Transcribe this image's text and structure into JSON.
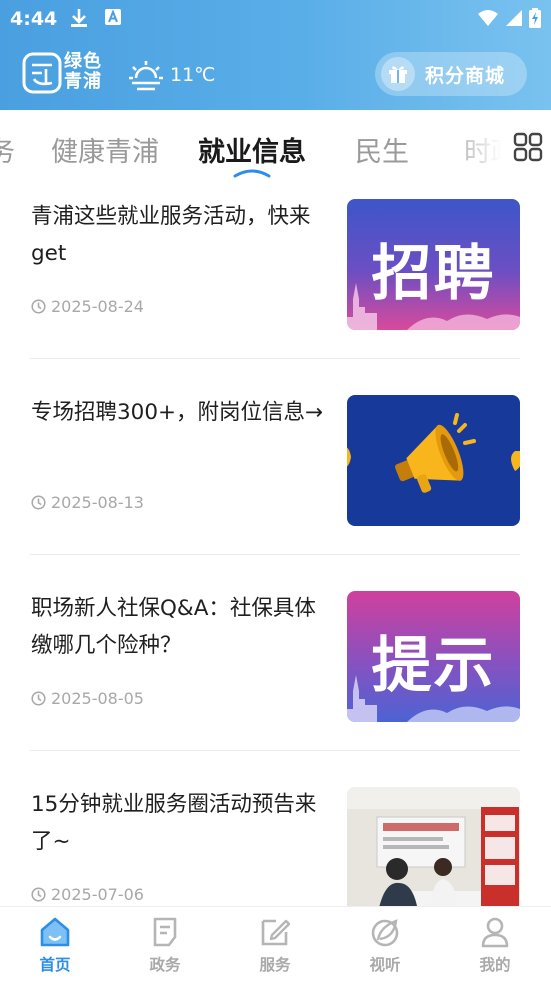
{
  "status_bar": {
    "time": "4:44"
  },
  "header": {
    "logo_line1": "绿色",
    "logo_line2": "青浦",
    "temperature": "11℃",
    "mall_label": "积分商城"
  },
  "tabs": [
    {
      "label": "务"
    },
    {
      "label": "健康青浦"
    },
    {
      "label": "就业信息",
      "active": true
    },
    {
      "label": "民生"
    },
    {
      "label": "时政"
    }
  ],
  "articles": [
    {
      "title": "青浦这些就业服务活动，快来get",
      "date": "2025-08-24",
      "thumb_text": "招聘",
      "thumb_kind": "banner"
    },
    {
      "title": "专场招聘300+，附岗位信息→",
      "date": "2025-08-13",
      "thumb_kind": "megaphone"
    },
    {
      "title": "职场新人社保Q&A：社保具体缴哪几个险种？",
      "date": "2025-08-05",
      "thumb_text": "提示",
      "thumb_kind": "banner"
    },
    {
      "title": "15分钟就业服务圈活动预告来了~",
      "date": "2025-07-06",
      "thumb_kind": "photo"
    }
  ],
  "bottom_nav": [
    {
      "label": "首页",
      "icon": "home-icon",
      "active": true
    },
    {
      "label": "政务",
      "icon": "document-icon"
    },
    {
      "label": "服务",
      "icon": "edit-icon"
    },
    {
      "label": "视听",
      "icon": "leaf-icon"
    },
    {
      "label": "我的",
      "icon": "person-icon"
    }
  ],
  "colors": {
    "accent": "#2c8ee8",
    "header_start": "#4a9fe0",
    "header_end": "#79c2ef"
  }
}
